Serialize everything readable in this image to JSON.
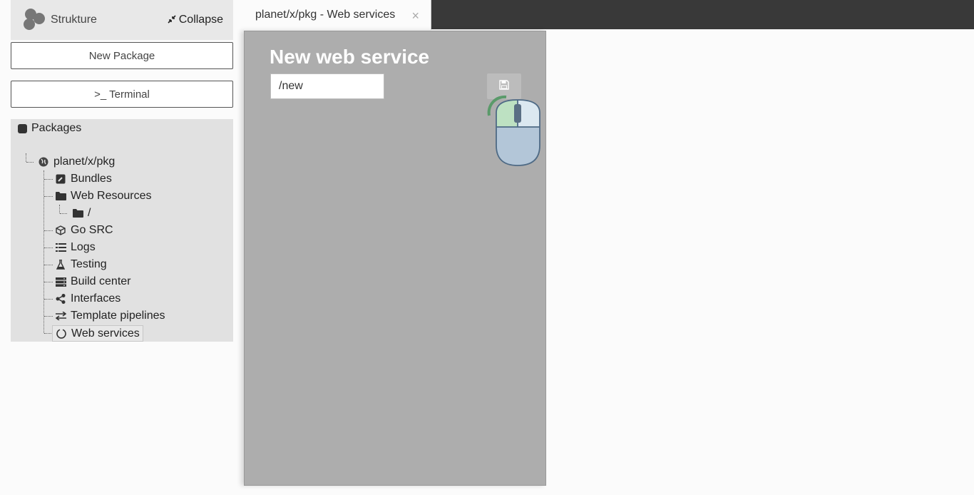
{
  "brand": {
    "name": "Strukture"
  },
  "sidebar": {
    "collapse_label": "Collapse",
    "new_package_label": "New Package",
    "terminal_label": ">_ Terminal",
    "packages_label": "Packages"
  },
  "tree": {
    "root": "planet/x/pkg",
    "items": [
      {
        "label": "Bundles",
        "icon": "bundle-icon"
      },
      {
        "label": "Web Resources",
        "icon": "folder-icon"
      },
      {
        "label": "/",
        "icon": "folder-icon"
      },
      {
        "label": "Go SRC",
        "icon": "cube-icon"
      },
      {
        "label": "Logs",
        "icon": "list-icon"
      },
      {
        "label": "Testing",
        "icon": "flask-icon"
      },
      {
        "label": "Build center",
        "icon": "server-icon"
      },
      {
        "label": "Interfaces",
        "icon": "share-icon"
      },
      {
        "label": "Template pipelines",
        "icon": "exchange-icon"
      },
      {
        "label": "Web services",
        "icon": "circle-icon"
      }
    ]
  },
  "tab": {
    "title": "planet/x/pkg - Web services",
    "close": "×"
  },
  "panel": {
    "title": "New web service",
    "input_value": "/new"
  },
  "colors": {
    "topbar": "#393939",
    "panel": "#adadad",
    "tree_bg": "#e1e1e1"
  }
}
